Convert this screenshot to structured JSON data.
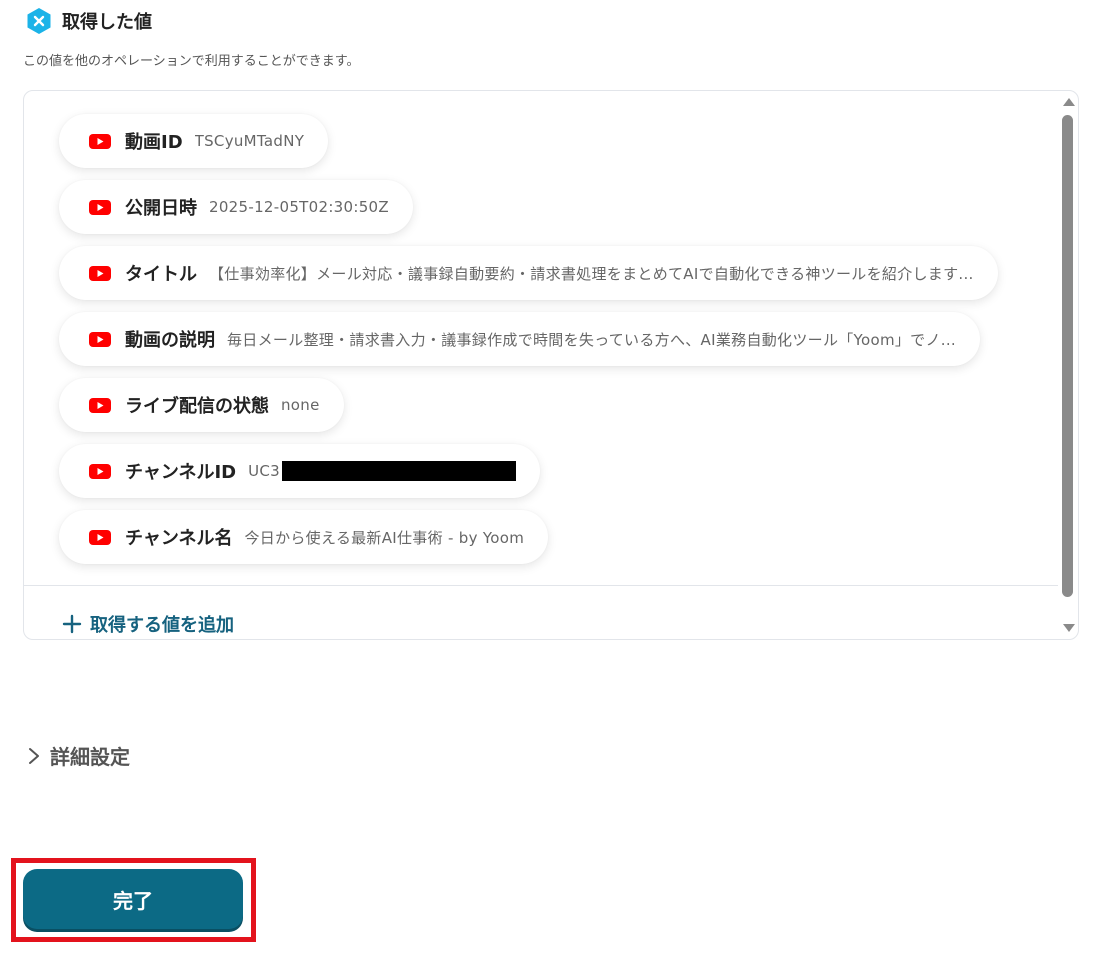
{
  "section": {
    "title": "取得した値",
    "description": "この値を他のオペレーションで利用することができます。"
  },
  "values": [
    {
      "label": "動画ID",
      "value": "TSCyuMTadNY",
      "icon": "youtube-icon"
    },
    {
      "label": "公開日時",
      "value": "2025-12-05T02:30:50Z",
      "icon": "youtube-icon"
    },
    {
      "label": "タイトル",
      "value": "【仕事効率化】メール対応・議事録自動要約・請求書処理をまとめてAIで自動化できる神ツールを紹介します...",
      "icon": "youtube-icon"
    },
    {
      "label": "動画の説明",
      "value": "毎日メール整理・請求書入力・議事録作成で時間を失っている方へ、AI業務自動化ツール「Yoom」でノ...",
      "icon": "youtube-icon"
    },
    {
      "label": "ライブ配信の状態",
      "value": "none",
      "icon": "youtube-icon"
    },
    {
      "label": "チャンネルID",
      "value": "UC3",
      "icon": "youtube-icon",
      "redacted": true
    },
    {
      "label": "チャンネル名",
      "value": "今日から使える最新AI仕事術 - by Yoom",
      "icon": "youtube-icon"
    }
  ],
  "add_value_label": "取得する値を追加",
  "advanced_settings_label": "詳細設定",
  "done_button_label": "完了",
  "colors": {
    "accent": "#0c6a85",
    "link": "#16627f",
    "youtube_red": "#ff0000",
    "highlight": "#e3131d",
    "hex_icon": "#1bb3e8"
  }
}
